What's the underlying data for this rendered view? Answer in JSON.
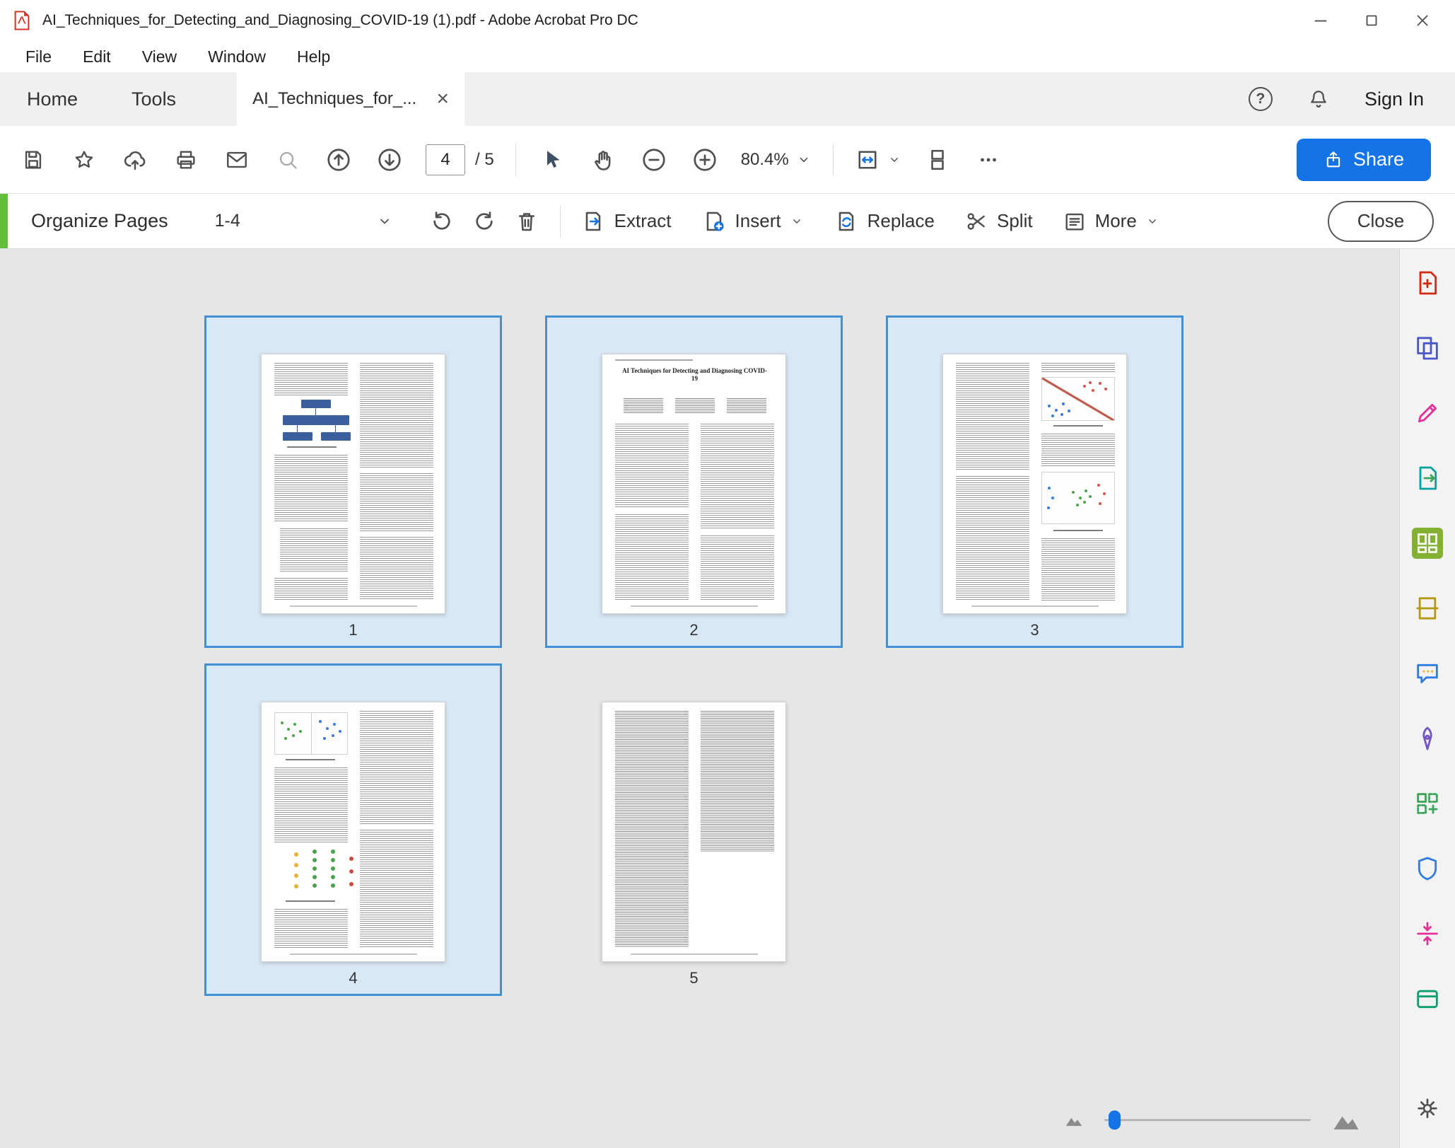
{
  "window": {
    "title": "AI_Techniques_for_Detecting_and_Diagnosing_COVID-19 (1).pdf - Adobe Acrobat Pro DC",
    "controls": [
      "minimize",
      "maximize",
      "close"
    ]
  },
  "menu": {
    "items": [
      "File",
      "Edit",
      "View",
      "Window",
      "Help"
    ]
  },
  "tabbar": {
    "home": "Home",
    "tools": "Tools",
    "document_tab": "AI_Techniques_for_...",
    "close_tab": "×",
    "help": "?",
    "sign_in": "Sign In"
  },
  "toolbar": {
    "page_current": "4",
    "page_total": "/ 5",
    "zoom_level": "80.4%",
    "share_label": "Share",
    "icons": [
      "save",
      "star-favorite",
      "cloud-upload",
      "print",
      "email",
      "search",
      "page-up",
      "page-down",
      "select-pointer",
      "hand-pan",
      "zoom-out",
      "zoom-in",
      "zoom-dropdown",
      "fit-width",
      "page-display",
      "more-options",
      "share"
    ]
  },
  "organize_bar": {
    "title": "Organize Pages",
    "page_range": "1-4",
    "buttons": {
      "extract": "Extract",
      "insert": "Insert",
      "replace": "Replace",
      "split": "Split",
      "more": "More",
      "close": "Close"
    },
    "icons": [
      "range-dropdown",
      "rotate-counterclockwise",
      "rotate-clockwise",
      "delete-pages",
      "extract-pages",
      "insert-pages",
      "replace-pages",
      "split-document",
      "more-options"
    ]
  },
  "document": {
    "page2_title": "AI Techniques for Detecting and Diagnosing COVID-19"
  },
  "pages": [
    {
      "number": "1",
      "selected": true
    },
    {
      "number": "2",
      "selected": true
    },
    {
      "number": "3",
      "selected": true
    },
    {
      "number": "4",
      "selected": true
    },
    {
      "number": "5",
      "selected": false
    }
  ],
  "right_rail": {
    "tools": [
      "create-pdf",
      "combine-files",
      "edit-pdf",
      "export-pdf",
      "organize-pages",
      "scan-ocr",
      "comment",
      "fill-sign",
      "prepare-form",
      "protect",
      "compress-pdf",
      "send-track",
      "settings"
    ],
    "active_tool": "organize-pages"
  },
  "thumbnail_slider": {
    "icons": [
      "zoom-small",
      "zoom-large"
    ],
    "handle_position": "left"
  },
  "colors": {
    "accent_blue": "#1473e6",
    "selection_border": "#4191d6",
    "selection_background": "#d9e8f7",
    "organize_accent_green": "#65be39",
    "active_tool_green": "#84b135"
  }
}
